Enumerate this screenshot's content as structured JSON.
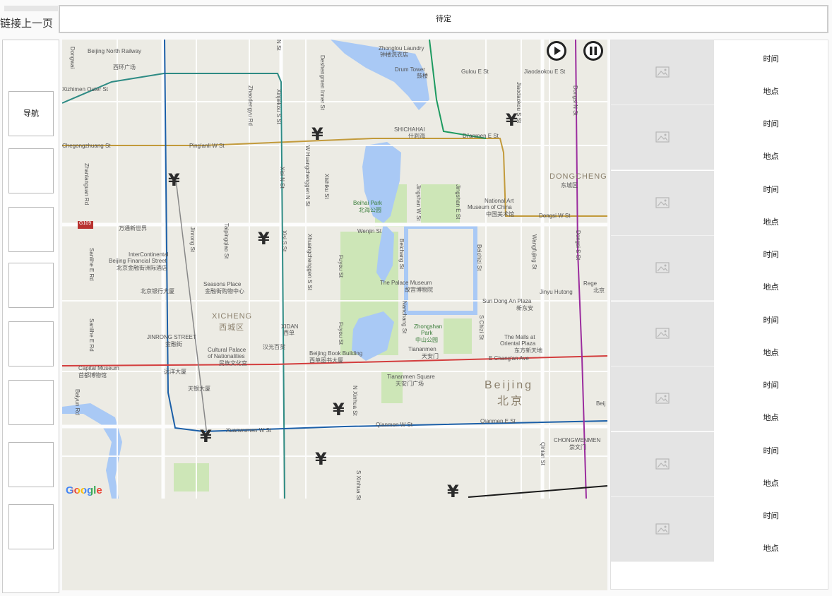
{
  "back_link": "链接上一页",
  "header": {
    "title": "待定"
  },
  "left_nav": {
    "items": [
      "导航",
      "",
      "",
      "",
      "",
      "",
      "",
      ""
    ]
  },
  "map": {
    "attribution": "Google",
    "controls": [
      {
        "icon": "play-circle-icon"
      },
      {
        "icon": "pause-circle-icon"
      }
    ],
    "marker_symbol": "¥",
    "labels": {
      "north_railway": "Beijing North Railway",
      "xihuan": "西环广场",
      "zhonglou": "Zhonglou Laundry",
      "zhonglou_cn": "钟楼洗衣店",
      "drum_tower": "Drum Tower",
      "drum_cn": "鼓楼",
      "gulou": "Gulou E St",
      "jiaodaokou": "Jiaodaokou E St",
      "xizhimen": "Xizhimen Outer St",
      "chegongzhuang": "Chegongzhuang St",
      "pinganli": "Ping'anli W St",
      "dianmen": "Di'anmen E St",
      "shichahai": "SHICHAHAI",
      "shichahai_cn": "什刹海",
      "dongcheng": "DONGCHENG",
      "dongcheng_cn": "东城区",
      "beihai": "Beihai Park",
      "beihai_cn": "北海公园",
      "nam": "National Art",
      "nam2": "Museum of China",
      "nam_cn": "中国美术馆",
      "dongsi": "Dongsi W St",
      "wantong": "万通新世界",
      "wenjin": "Wenjin St",
      "intercontinental": "InterContinental",
      "ic2": "Beijing Financial Street",
      "ic_cn": "北京金融街洲际酒店",
      "seasons": "Seasons Place",
      "seasons_cn": "金融街购物中心",
      "palace": "The Palace Museum",
      "palace_cn": "故宫博物院",
      "sundong": "Sun Dong An Plaza",
      "sundong_cn": "新东安",
      "jinyu": "Jinyu Hutong",
      "boc": "北京银行大厦",
      "xicheng": "XICHENG",
      "xicheng_cn": "西城区",
      "xidan": "XIDAN",
      "xidan_cn": "西单",
      "zhongshan": "Zhongshan",
      "zhongshan2": "Park",
      "zhongshan_cn": "中山公园",
      "tiananmen": "Tiananmen",
      "tiananmen_cn": "天安门",
      "malls": "The Malls at",
      "malls2": "Oriental Plaza",
      "malls_cn": "东方新天地",
      "jinrong": "JINRONG STREET",
      "jinrong_cn": "金融街",
      "hanguang": "汉光百货",
      "cultural": "Cultural Palace",
      "cultural2": "of Nationalities",
      "cultural_cn": "民族文化宫",
      "bookbuilding": "Beijing Book Building",
      "bookbuilding_cn": "西单图书大厦",
      "echangan": "E Chang'an Ave",
      "capital": "Capital Museum",
      "capital_cn": "首都博物馆",
      "yuanyang": "远洋大厦",
      "tiananmen_sq": "Tiananmen Square",
      "tiananmen_sq_cn": "天安门广场",
      "beijing": "Beijing",
      "beijing_cn": "北京",
      "tianyin": "天银大厦",
      "xuanwumen": "Xuanwumen W St",
      "qianmen_w": "Qianmen W St",
      "qianmen_e": "Qianmen E St",
      "chongwenmen": "CHONGWENMEN",
      "chongwenmen_cn": "崇文门",
      "g109": "G109",
      "zhanlan": "Zhanlanguan Rd",
      "sanlihe": "Sanlihe E Rd",
      "sanlihe2": "Sanlihe E Rd",
      "baiyun": "Baiyun Rd",
      "zhaodengyu": "Zhaodengyu Rd",
      "xinjiekou": "Xinjiekou S St",
      "deshengmen": "Deshengmen Inner St",
      "whuangcheng": "W Huangchenggen N St",
      "xishiku": "Xishiku St",
      "xisi": "Xisi N St",
      "xisi_s": "Xisi S St",
      "xhuangcheng_s": "Xhuangchenggen S St",
      "fuyou": "Fuyou St",
      "fuyou2": "Fuyou St",
      "jingshan_w": "Jingshan W St",
      "jingshan_e": "Jingshan E St",
      "beichang": "Beichang St",
      "beichizi": "Beichizi St",
      "nanchang": "Nanchang St",
      "schizi": "S Chizi St",
      "wangfujing": "Wangfujing St",
      "dongsi_n": "Dongsi N St",
      "dongsi_s": "Dongsi S St",
      "jiaodaokou_s": "Jiaodaokou S St",
      "jinrong_st": "Jinrong St",
      "taipingqiao": "Taipingqiao St",
      "nxinhua": "N Xinhua St",
      "sxinhua": "S Xinhua St",
      "qianshui": "Qinian St",
      "dongzhimen": "Dongzhimen N St",
      "ns": "N St",
      "rege": "Rege",
      "rege_cn": "北京",
      "beij": "Beij",
      "dongwai": "Dongwai"
    }
  },
  "records": [
    {
      "time": "时间",
      "place": "地点"
    },
    {
      "time": "时间",
      "place": "地点"
    },
    {
      "time": "时间",
      "place": "地点"
    },
    {
      "time": "时间",
      "place": "地点"
    },
    {
      "time": "时间",
      "place": "地点"
    },
    {
      "time": "时间",
      "place": "地点"
    },
    {
      "time": "时间",
      "place": "地点"
    },
    {
      "time": "时间",
      "place": "地点"
    }
  ],
  "colors": {
    "map_bg": "#ecebe4",
    "water": "#a9c9f5",
    "park": "#cde6b7",
    "road_major": "#ffffff",
    "road_ring": "#c29a3b",
    "subway_blue": "#1b5fa8",
    "subway_red": "#d33d3d",
    "subway_purple": "#9b2c9e",
    "subway_teal": "#2e8b84",
    "thumb_bg": "#e4e4e4"
  }
}
